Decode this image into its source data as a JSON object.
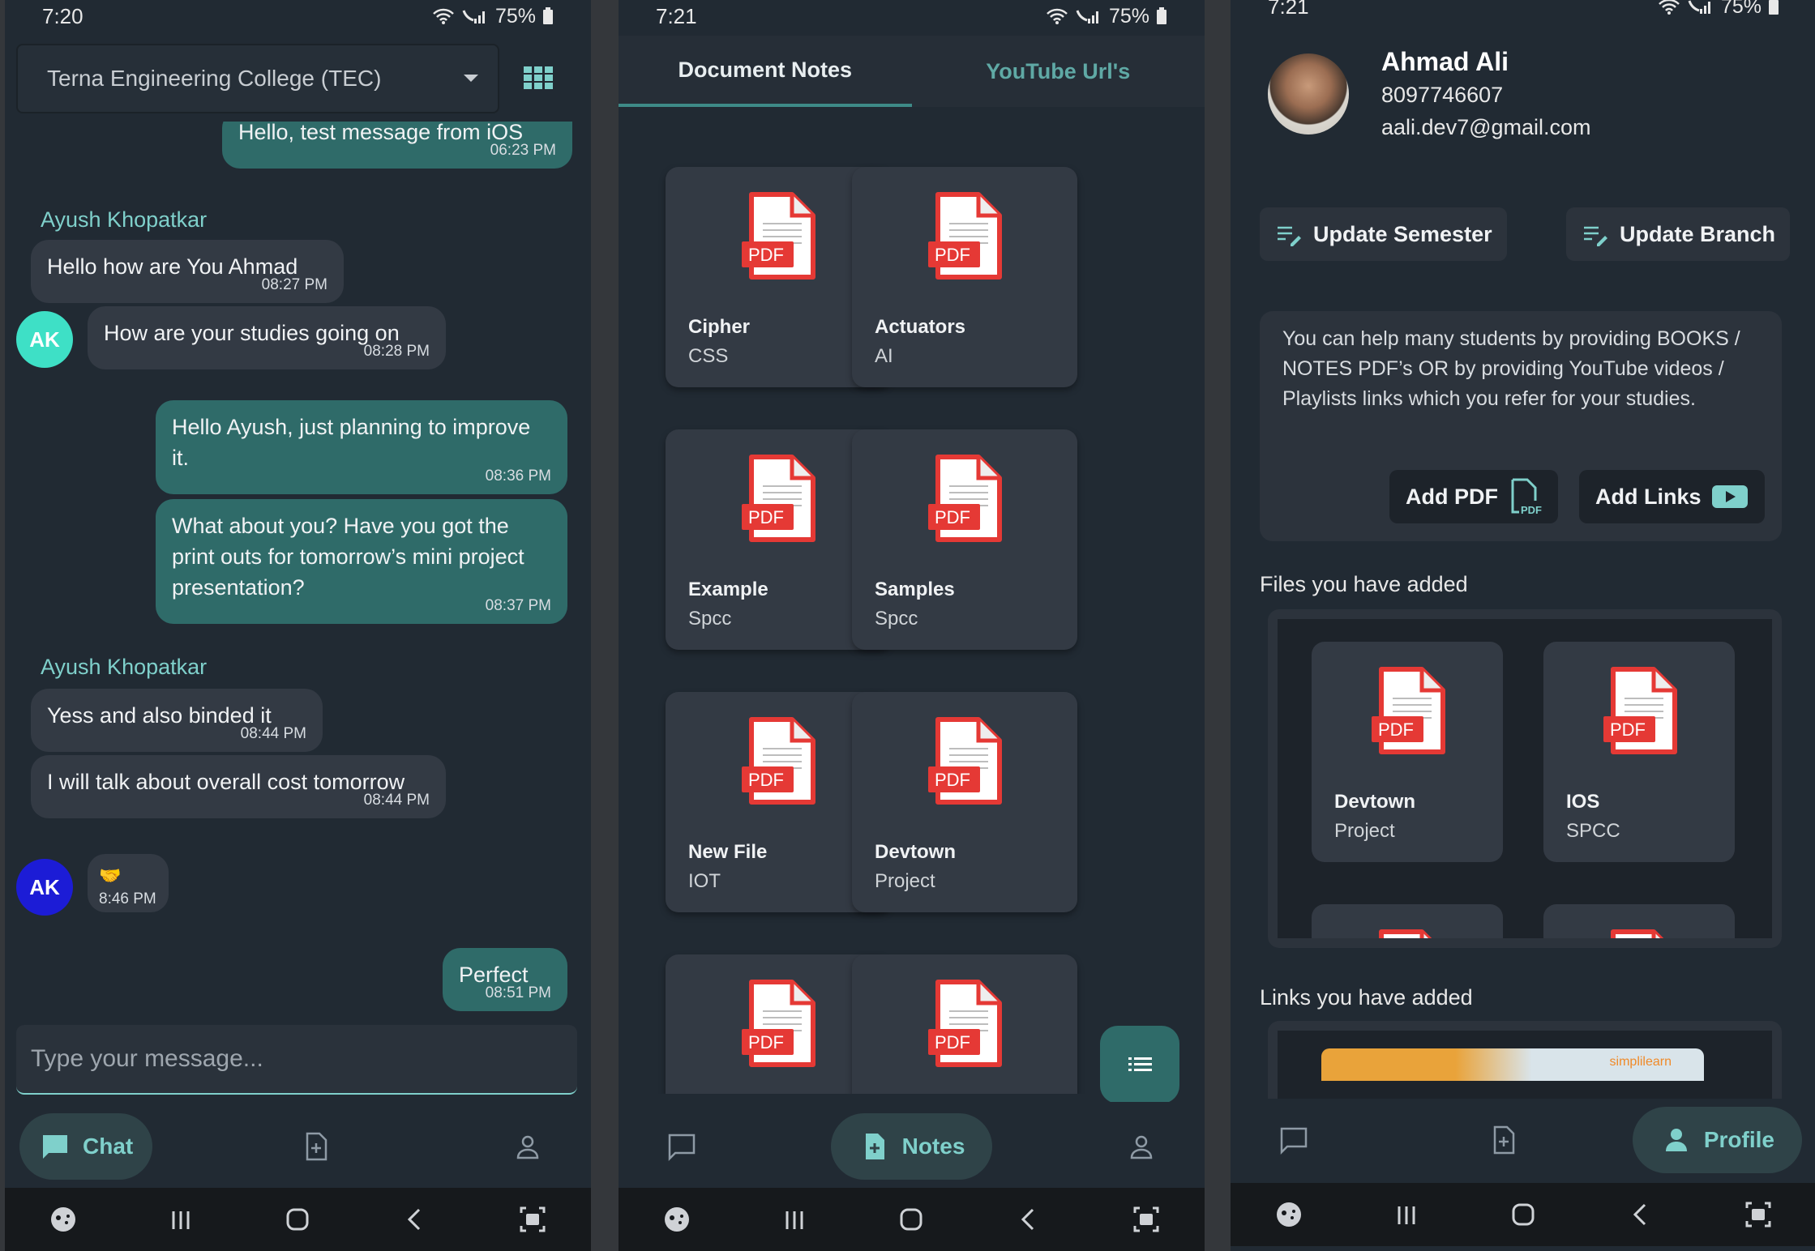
{
  "chat": {
    "status_time": "7:20",
    "battery": "75%",
    "college": "Terna Engineering College (TEC)",
    "messages": [
      {
        "dir": "out",
        "text": "Hello, test message from iOS",
        "time": "06:23 PM"
      },
      {
        "sender": "Ayush Khopatkar"
      },
      {
        "dir": "in",
        "text": "Hello how are You Ahmad",
        "time": "08:27 PM"
      },
      {
        "dir": "in",
        "text": "How are your studies going on",
        "time": "08:28 PM",
        "avatar": "AK"
      },
      {
        "dir": "out",
        "text": "Hello Ayush, just planning to improve it.",
        "time": "08:36 PM"
      },
      {
        "dir": "out",
        "text": "What about you? Have you got the print outs for tomorrow’s mini project presentation?",
        "time": "08:37 PM"
      },
      {
        "sender": "Ayush Khopatkar"
      },
      {
        "dir": "in",
        "text": "Yess and also binded it",
        "time": "08:44 PM"
      },
      {
        "dir": "in",
        "text": "I will talk about overall cost tomorrow",
        "time": "08:44 PM"
      },
      {
        "dir": "in",
        "text": "🤝",
        "time": "8:46 PM",
        "avatar": "AK"
      },
      {
        "dir": "out",
        "text": "Perfect",
        "time": "08:51 PM"
      }
    ],
    "input_placeholder": "Type your message...",
    "nav_chat": "Chat"
  },
  "notes": {
    "status_time": "7:21",
    "battery": "75%",
    "tabs": [
      "Document Notes",
      "YouTube Url's"
    ],
    "cards": [
      {
        "title": "Cipher",
        "sub": "CSS"
      },
      {
        "title": "Actuators",
        "sub": "AI"
      },
      {
        "title": "Example",
        "sub": "Spcc"
      },
      {
        "title": "Samples",
        "sub": "Spcc"
      },
      {
        "title": "New File",
        "sub": "IOT"
      },
      {
        "title": "Devtown",
        "sub": "Project"
      },
      {
        "title": "",
        "sub": ""
      },
      {
        "title": "",
        "sub": ""
      }
    ],
    "pdf_label": "PDF",
    "nav_notes": "Notes"
  },
  "profile": {
    "status_time": "7:21",
    "battery": "75%",
    "name": "Ahmad Ali",
    "phone": "8097746607",
    "email": "aali.dev7@gmail.com",
    "update_semester": "Update Semester",
    "update_branch": "Update Branch",
    "info": "You can help many students by providing BOOKS / NOTES PDF’s OR by providing YouTube videos / Playlists links which you refer for your studies.",
    "add_pdf": "Add PDF",
    "add_links": "Add Links",
    "files_heading": "Files you have added",
    "files": [
      {
        "title": "Devtown",
        "sub": "Project"
      },
      {
        "title": "IOS",
        "sub": "SPCC"
      }
    ],
    "links_heading": "Links you have added",
    "link_thumb_text": "simplilearn",
    "nav_profile": "Profile"
  }
}
